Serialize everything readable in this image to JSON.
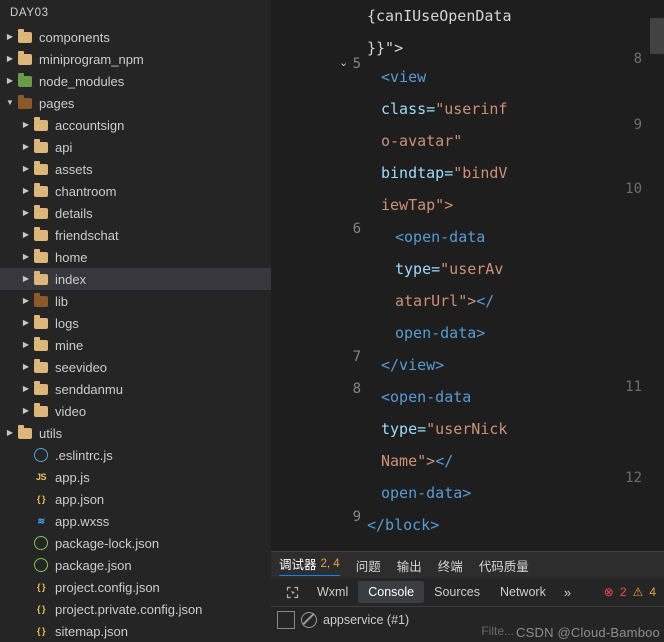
{
  "sidebar": {
    "title": "DAY03",
    "items": [
      {
        "label": "components",
        "indent": 1,
        "type": "folder",
        "expanded": false
      },
      {
        "label": "miniprogram_npm",
        "indent": 1,
        "type": "folder",
        "expanded": false
      },
      {
        "label": "node_modules",
        "indent": 1,
        "type": "folder-green",
        "expanded": false
      },
      {
        "label": "pages",
        "indent": 1,
        "type": "folder-special",
        "expanded": true
      },
      {
        "label": "accountsign",
        "indent": 2,
        "type": "folder",
        "expanded": false
      },
      {
        "label": "api",
        "indent": 2,
        "type": "folder",
        "expanded": false
      },
      {
        "label": "assets",
        "indent": 2,
        "type": "folder",
        "expanded": false
      },
      {
        "label": "chantroom",
        "indent": 2,
        "type": "folder",
        "expanded": false
      },
      {
        "label": "details",
        "indent": 2,
        "type": "folder",
        "expanded": false
      },
      {
        "label": "friendschat",
        "indent": 2,
        "type": "folder",
        "expanded": false
      },
      {
        "label": "home",
        "indent": 2,
        "type": "folder",
        "expanded": false
      },
      {
        "label": "index",
        "indent": 2,
        "type": "folder",
        "expanded": false,
        "selected": true
      },
      {
        "label": "lib",
        "indent": 2,
        "type": "folder-special",
        "expanded": false
      },
      {
        "label": "logs",
        "indent": 2,
        "type": "folder",
        "expanded": false
      },
      {
        "label": "mine",
        "indent": 2,
        "type": "folder",
        "expanded": false
      },
      {
        "label": "seevideo",
        "indent": 2,
        "type": "folder",
        "expanded": false
      },
      {
        "label": "senddanmu",
        "indent": 2,
        "type": "folder",
        "expanded": false
      },
      {
        "label": "video",
        "indent": 2,
        "type": "folder",
        "expanded": false
      },
      {
        "label": "utils",
        "indent": 1,
        "type": "folder",
        "expanded": false
      },
      {
        "label": ".eslintrc.js",
        "indent": 2,
        "type": "file-circle-blue"
      },
      {
        "label": "app.js",
        "indent": 2,
        "type": "file-js"
      },
      {
        "label": "app.json",
        "indent": 2,
        "type": "file-json"
      },
      {
        "label": "app.wxss",
        "indent": 2,
        "type": "file-wxss"
      },
      {
        "label": "package-lock.json",
        "indent": 2,
        "type": "file-circle-green"
      },
      {
        "label": "package.json",
        "indent": 2,
        "type": "file-circle-green"
      },
      {
        "label": "project.config.json",
        "indent": 2,
        "type": "file-json"
      },
      {
        "label": "project.private.config.json",
        "indent": 2,
        "type": "file-json"
      },
      {
        "label": "sitemap.json",
        "indent": 2,
        "type": "file-json"
      }
    ]
  },
  "editor": {
    "left_line_numbers": [
      "5",
      "6",
      "7",
      "8",
      "9"
    ],
    "right_line_numbers": [
      "8",
      "9",
      "10",
      "11",
      "12"
    ],
    "lines": [
      {
        "indent": 0,
        "parts": [
          {
            "t": "{canIUseOpenData",
            "c": "plain"
          }
        ]
      },
      {
        "indent": 0,
        "parts": [
          {
            "t": "}}\">",
            "c": "plain"
          }
        ]
      },
      {
        "indent": 1,
        "parts": [
          {
            "t": "<view",
            "c": "tag"
          }
        ]
      },
      {
        "indent": 1,
        "parts": [
          {
            "t": "class=",
            "c": "attr"
          },
          {
            "t": "\"userinf",
            "c": "str"
          }
        ]
      },
      {
        "indent": 1,
        "parts": [
          {
            "t": "o-avatar\"",
            "c": "str"
          }
        ]
      },
      {
        "indent": 1,
        "parts": [
          {
            "t": "bindtap=",
            "c": "attr"
          },
          {
            "t": "\"bindV",
            "c": "str"
          }
        ]
      },
      {
        "indent": 1,
        "parts": [
          {
            "t": "iewTap\">",
            "c": "str"
          }
        ]
      },
      {
        "indent": 2,
        "parts": [
          {
            "t": "<open-data",
            "c": "tag"
          }
        ]
      },
      {
        "indent": 2,
        "parts": [
          {
            "t": "type=",
            "c": "attr"
          },
          {
            "t": "\"userAv",
            "c": "str"
          }
        ]
      },
      {
        "indent": 2,
        "parts": [
          {
            "t": "atarUrl\">",
            "c": "str"
          },
          {
            "t": "</",
            "c": "tag"
          }
        ]
      },
      {
        "indent": 2,
        "parts": [
          {
            "t": "open-data>",
            "c": "tag"
          }
        ]
      },
      {
        "indent": 1,
        "parts": [
          {
            "t": "</view>",
            "c": "tag"
          }
        ]
      },
      {
        "indent": 1,
        "parts": [
          {
            "t": "<open-data",
            "c": "tag"
          }
        ]
      },
      {
        "indent": 1,
        "parts": [
          {
            "t": "type=",
            "c": "attr"
          },
          {
            "t": "\"userNick",
            "c": "str"
          }
        ]
      },
      {
        "indent": 1,
        "parts": [
          {
            "t": "Name\">",
            "c": "str"
          },
          {
            "t": "</",
            "c": "tag"
          }
        ]
      },
      {
        "indent": 1,
        "parts": [
          {
            "t": "open-data>",
            "c": "tag"
          }
        ]
      },
      {
        "indent": 0,
        "parts": [
          {
            "t": "</block>",
            "c": "tag"
          }
        ]
      }
    ]
  },
  "devtools": {
    "top_tabs": [
      {
        "label": "调试器",
        "active": true,
        "badge": "2, 4"
      },
      {
        "label": "问题",
        "active": false
      },
      {
        "label": "输出",
        "active": false
      },
      {
        "label": "终端",
        "active": false
      },
      {
        "label": "代码质量",
        "active": false
      }
    ],
    "bottom_tabs": [
      {
        "label": "Wxml",
        "active": false
      },
      {
        "label": "Console",
        "active": true
      },
      {
        "label": "Sources",
        "active": false
      },
      {
        "label": "Network",
        "active": false
      }
    ],
    "overflow_label": "»",
    "error_count": "2",
    "warning_count": "4",
    "console": {
      "context": "appservice (#1)",
      "filter_placeholder": "Filte..."
    }
  },
  "watermark": "CSDN @Cloud-Bamboo"
}
